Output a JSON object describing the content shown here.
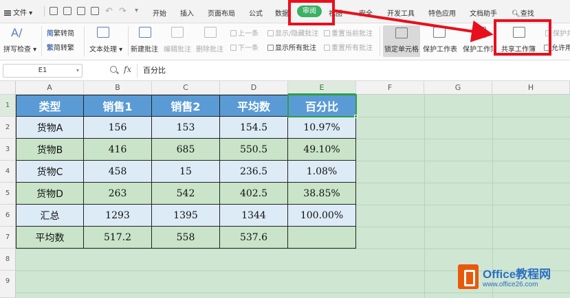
{
  "menu": {
    "file": "文件",
    "tabs": [
      "开始",
      "插入",
      "页面布局",
      "公式",
      "数据",
      "审阅",
      "视图",
      "安全",
      "开发工具",
      "特色应用",
      "文档助手"
    ],
    "search": "查找"
  },
  "ribbon": {
    "spellcheck": "拼写检查",
    "trad_to_simp": "繁转简",
    "simp_to_trad": "简转繁",
    "text_process": "文本处理",
    "new_comment": "新建批注",
    "edit_comment": "编辑批注",
    "delete_comment": "删除批注",
    "prev": "上一条",
    "next": "下一条",
    "show_hide_comment": "显示/隐藏批注",
    "show_all_comments": "显示所有批注",
    "reset_current_comment": "重置当前批注",
    "reset_all_comments": "重置所有批注",
    "lock_cell": "锁定单元格",
    "protect_sheet": "保护工作表",
    "protect_workbook": "保护工作簿",
    "share_workbook": "共享工作簿",
    "protect_share": "保护共",
    "allow_edit": "允许用"
  },
  "formula_bar": {
    "name_box": "E1",
    "fx": "fx",
    "value": "百分比"
  },
  "columns": [
    "A",
    "B",
    "C",
    "D",
    "E",
    "F",
    "G",
    "H"
  ],
  "rows": [
    "1",
    "2",
    "3",
    "4",
    "5",
    "6",
    "7",
    "8",
    "9"
  ],
  "table": {
    "header": [
      "类型",
      "销售1",
      "销售2",
      "平均数",
      "百分比"
    ],
    "rows": [
      [
        "货物A",
        "156",
        "153",
        "154.5",
        "10.97%"
      ],
      [
        "货物B",
        "416",
        "685",
        "550.5",
        "49.10%"
      ],
      [
        "货物C",
        "458",
        "15",
        "236.5",
        "1.08%"
      ],
      [
        "货物D",
        "263",
        "542",
        "402.5",
        "38.85%"
      ],
      [
        "汇总",
        "1293",
        "1395",
        "1344",
        "100.00%"
      ],
      [
        "平均数",
        "517.2",
        "558",
        "537.6",
        ""
      ]
    ]
  },
  "colors": {
    "header_fill": "#5b9bd5",
    "row_blue": "#ddebf7",
    "row_green": "#c9e4c9",
    "sheet_bg": "#cfe6d2",
    "accent_green": "#3cb064",
    "annotation_red": "#e8101d"
  },
  "watermark": {
    "title": "Office教程网",
    "url": "www.office26.com"
  }
}
